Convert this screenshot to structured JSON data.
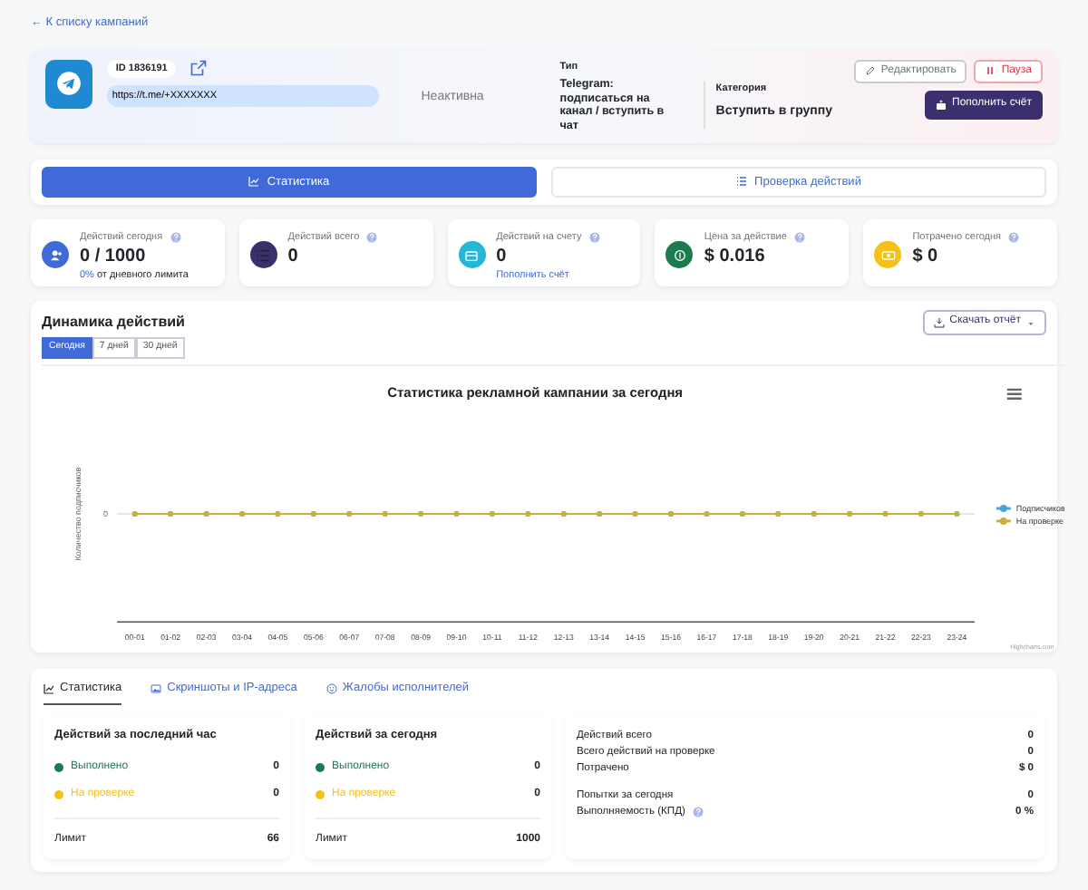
{
  "back_link": "← К списку кампаний",
  "campaign": {
    "id_label": "ID 1836191",
    "url": "https://t.me/+XXXXXXX",
    "status": "Неактивна",
    "type_label": "Тип",
    "type": "Telegram: подписаться на канал / вступить в чат",
    "category_label": "Категория",
    "category": "Вступить в группу"
  },
  "actions": [
    {
      "label": "Редактировать",
      "kind": "edit"
    },
    {
      "label": "Пауза",
      "kind": "pause"
    },
    {
      "label": "Пополнить счёт",
      "kind": "topup"
    }
  ],
  "view_tabs": [
    {
      "label": "Статистика",
      "kind": "chart",
      "selected": true
    },
    {
      "label": "Проверка действий",
      "kind": "list",
      "selected": false
    }
  ],
  "metrics": [
    {
      "label": "Действий сегодня",
      "value": "0 / 1000",
      "note_highlight": "0%",
      "note": "от дневного лимита",
      "color": "#3f6ad8",
      "kind": "users"
    },
    {
      "label": "Действий всего",
      "value": "0",
      "color": "#3b2f6e",
      "kind": "list"
    },
    {
      "label": "Действий на счету",
      "value": "0",
      "link": "Пополнить счёт",
      "color": "#22b8d6",
      "kind": "wallet"
    },
    {
      "label": "Цена за действие",
      "value": "$ 0.016",
      "color": "#1c7a4f",
      "kind": "coin"
    },
    {
      "label": "Потрачено сегодня",
      "value": "$ 0",
      "color": "#f5c116",
      "kind": "cash"
    }
  ],
  "dynamics": {
    "title": "Динамика действий",
    "download": "Скачать отчёт",
    "ranges": [
      {
        "label": "Сегодня",
        "selected": true
      },
      {
        "label": "7 дней",
        "selected": false
      },
      {
        "label": "30 дней",
        "selected": false
      }
    ],
    "chart": {
      "title": "Статистика рекламной кампании за сегодня",
      "ylabel": "Количество подписчиков",
      "y_tick": "0",
      "x_labels": [
        "00-01",
        "01-02",
        "02-03",
        "03-04",
        "04-05",
        "05-06",
        "06-07",
        "07-08",
        "08-09",
        "09-10",
        "10-11",
        "11-12",
        "12-13",
        "13-14",
        "14-15",
        "15-16",
        "16-17",
        "17-18",
        "18-19",
        "19-20",
        "20-21",
        "21-22",
        "22-23",
        "23-24"
      ],
      "legend": [
        {
          "name": "Подписчиков",
          "color": "#4aa3df"
        },
        {
          "name": "На проверке",
          "color": "#c9b03a"
        }
      ]
    },
    "credit": "Highcharts.com"
  },
  "detail_tabs": [
    {
      "label": "Статистика",
      "kind": "chart",
      "selected": true
    },
    {
      "label": "Скриншоты и IP-адреса",
      "kind": "image",
      "selected": false
    },
    {
      "label": "Жалобы исполнителей",
      "kind": "smile",
      "selected": false
    }
  ],
  "panels": [
    {
      "title": "Действий за последний час",
      "rows": [
        {
          "label": "Выполнено",
          "value": "0",
          "color": "#1c7a4f"
        },
        {
          "label": "На проверке",
          "value": "0",
          "color": "#f5c116"
        }
      ],
      "limit_label": "Лимит",
      "limit": "66"
    },
    {
      "title": "Действий за сегодня",
      "rows": [
        {
          "label": "Выполнено",
          "value": "0",
          "color": "#1c7a4f"
        },
        {
          "label": "На проверке",
          "value": "0",
          "color": "#f5c116"
        }
      ],
      "limit_label": "Лимит",
      "limit": "1000"
    }
  ],
  "summary": [
    [
      {
        "label": "Действий всего",
        "value": "0",
        "help": false
      },
      {
        "label": "Всего действий на проверке",
        "value": "0",
        "help": false
      },
      {
        "label": "Потрачено",
        "value": "$ 0",
        "help": false
      }
    ],
    [
      {
        "label": "Попытки за сегодня",
        "value": "0",
        "help": false
      },
      {
        "label": "Выполняемость (КПД)",
        "value": "0 %",
        "help": true
      }
    ]
  ]
}
